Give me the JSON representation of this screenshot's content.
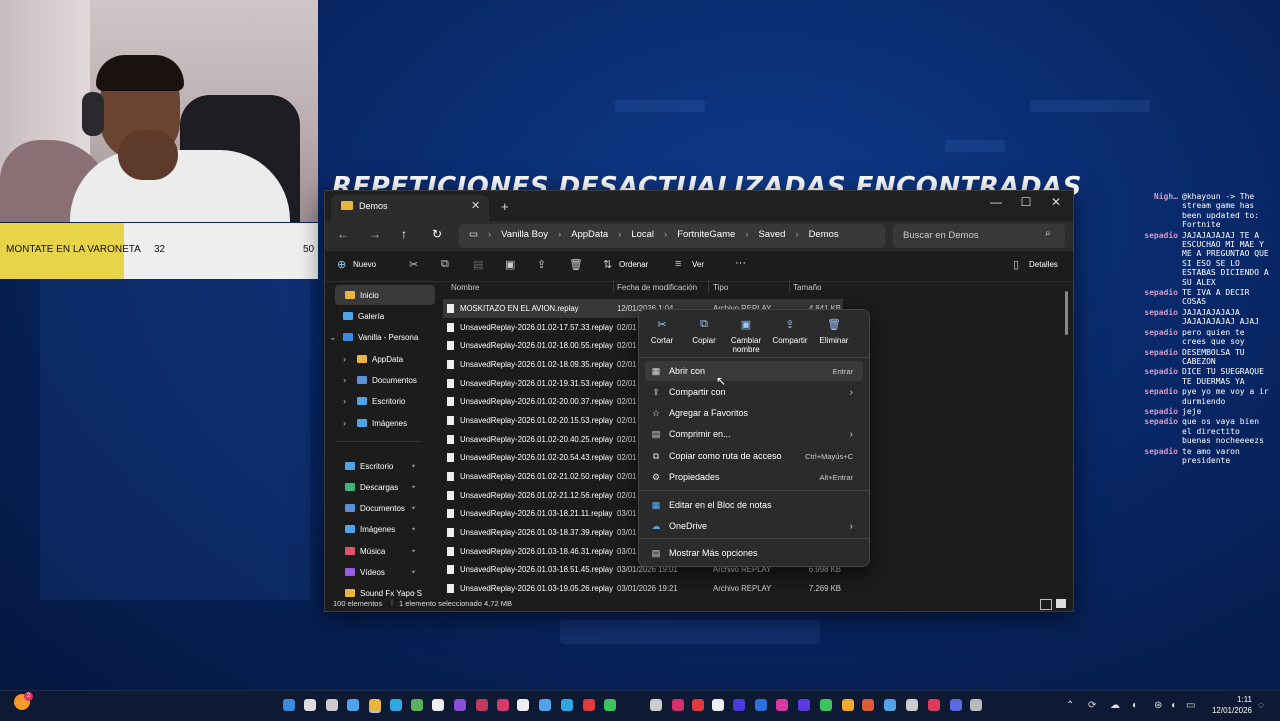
{
  "background": {
    "game_title": "REPETICIONES DESACTUALIZADAS ENCONTRADAS"
  },
  "poll": {
    "label": "MONTATE EN LA VARONETA",
    "left_value": "32",
    "right_value": "50",
    "left_fraction": 0.39,
    "accent_color": "#e8d448"
  },
  "chat": {
    "messages": [
      {
        "user": "Nigh…",
        "text": "@khayoun -> The stream game has been updated to: Fortnite"
      },
      {
        "user": "sepadio",
        "text": "JAJAJAJAJAJ TE A ESCUCHAO MI MAE Y ME A PREGUNTAO QUE SI ESO SE LO ESTABAS DICIENDO A SU ALEX"
      },
      {
        "user": "sepadio",
        "text": "TE IVA A DECIR COSAS"
      },
      {
        "user": "sepadio",
        "text": "JAJAJAJAJAJA JAJAJAJAJAJ AJAJ"
      },
      {
        "user": "sepadio",
        "text": "pero quien te crees que soy"
      },
      {
        "user": "sepadio",
        "text": "DESEMBOLSA TU CABEZON"
      },
      {
        "user": "sepadio",
        "text": "DICE TU SUEGRAQUE TE DUERMAS YA"
      },
      {
        "user": "sepadio",
        "text": "pye yo me voy a ir durmiendo"
      },
      {
        "user": "sepadio",
        "text": "jeje"
      },
      {
        "user": "sepadio",
        "text": "que os vaya bien el directito buenas nocheeeezs"
      },
      {
        "user": "sepadio",
        "text": "te amo varon presidente"
      }
    ]
  },
  "explorer": {
    "tab_title": "Demos",
    "breadcrumbs": [
      "Vanilla Boy",
      "AppData",
      "Local",
      "FortniteGame",
      "Saved",
      "Demos"
    ],
    "search_placeholder": "Buscar en Demos",
    "toolbar": {
      "new_label": "Nuevo",
      "sort_label": "Ordenar",
      "view_label": "Ver",
      "more_label": "···",
      "details_label": "Detalles"
    },
    "columns": {
      "name": "Nombre",
      "date": "Fecha de modificación",
      "type": "Tipo",
      "size": "Tamaño"
    },
    "sidebar": [
      {
        "label": "Inicio",
        "selected": true,
        "color": "#e9b53f"
      },
      {
        "label": "Galería",
        "color": "#4fa3e8"
      },
      {
        "label": "Vanilla - Persona",
        "color": "#3b8be0"
      },
      {
        "label": "AppData",
        "color": "#e9b53f"
      },
      {
        "label": "Documentos",
        "color": "#5b8fd6"
      },
      {
        "label": "Escritorio",
        "color": "#4fa3e8"
      },
      {
        "label": "Imágenes",
        "color": "#4fa3e8"
      },
      {
        "label": "Escritorio",
        "color": "#4fa3e8"
      },
      {
        "label": "Descargas",
        "color": "#3fb47a"
      },
      {
        "label": "Documentos",
        "color": "#5b8fd6"
      },
      {
        "label": "Imágenes",
        "color": "#4fa3e8"
      },
      {
        "label": "Música",
        "color": "#e0526d"
      },
      {
        "label": "Vídeos",
        "color": "#9a5ce0"
      },
      {
        "label": "Sound Fx Yapo S",
        "color": "#e9b53f"
      }
    ],
    "files": [
      {
        "name": "MOSKITAZO EN EL AVION.replay",
        "date": "12/01/2026 1:04",
        "type": "Archivo REPLAY",
        "size": "4.841 KB",
        "selected": true
      },
      {
        "name": "UnsavedReplay-2026.01.02-17.57.33.replay",
        "date": "02/01",
        "type": "",
        "size": ""
      },
      {
        "name": "UnsavedReplay-2026.01.02-18.00.55.replay",
        "date": "02/01",
        "type": "",
        "size": ""
      },
      {
        "name": "UnsavedReplay-2026.01.02-18.09.35.replay",
        "date": "02/01",
        "type": "",
        "size": ""
      },
      {
        "name": "UnsavedReplay-2026.01.02-19.31.53.replay",
        "date": "02/01",
        "type": "",
        "size": ""
      },
      {
        "name": "UnsavedReplay-2026.01.02-20.00.37.replay",
        "date": "02/01",
        "type": "",
        "size": ""
      },
      {
        "name": "UnsavedReplay-2026.01.02-20.15.53.replay",
        "date": "02/01",
        "type": "",
        "size": ""
      },
      {
        "name": "UnsavedReplay-2026.01.02-20.40.25.replay",
        "date": "02/01",
        "type": "",
        "size": ""
      },
      {
        "name": "UnsavedReplay-2026.01.02-20.54.43.replay",
        "date": "02/01",
        "type": "",
        "size": ""
      },
      {
        "name": "UnsavedReplay-2026.01.02-21.02.50.replay",
        "date": "02/01",
        "type": "",
        "size": ""
      },
      {
        "name": "UnsavedReplay-2026.01.02-21.12.56.replay",
        "date": "02/01",
        "type": "",
        "size": ""
      },
      {
        "name": "UnsavedReplay-2026.01.03-18.21.11.replay",
        "date": "03/01",
        "type": "",
        "size": ""
      },
      {
        "name": "UnsavedReplay-2026.01.03-18.37.39.replay",
        "date": "03/01",
        "type": "",
        "size": ""
      },
      {
        "name": "UnsavedReplay-2026.01.03-18.46.31.replay",
        "date": "03/01",
        "type": "",
        "size": ""
      },
      {
        "name": "UnsavedReplay-2026.01.03-18.51.45.replay",
        "date": "03/01/2026 19:01",
        "type": "Archivo REPLAY",
        "size": "6.998 KB"
      },
      {
        "name": "UnsavedReplay-2026.01.03-19.05.26.replay",
        "date": "03/01/2026 19:21",
        "type": "Archivo REPLAY",
        "size": "7.269 KB"
      }
    ],
    "status": {
      "count": "100 elementos",
      "selection": "1 elemento seleccionado 4,72 MB"
    }
  },
  "context_menu": {
    "quick_actions": [
      {
        "label": "Cortar",
        "icon": "scissors-icon"
      },
      {
        "label": "Copiar",
        "icon": "copy-icon"
      },
      {
        "label": "Cambiar nombre",
        "icon": "rename-icon"
      },
      {
        "label": "Compartir",
        "icon": "share-icon"
      },
      {
        "label": "Eliminar",
        "icon": "trash-icon"
      }
    ],
    "items": [
      {
        "label": "Abrir con",
        "shortcut": "Entrar",
        "submenu": false
      },
      {
        "label": "Compartir con",
        "shortcut": "",
        "submenu": true
      },
      {
        "label": "Agregar a Favoritos",
        "shortcut": "",
        "submenu": false
      },
      {
        "label": "Comprimir en...",
        "shortcut": "",
        "submenu": true
      },
      {
        "label": "Copiar como ruta de acceso",
        "shortcut": "Ctrl+Mayús+C",
        "submenu": false
      },
      {
        "label": "Propiedades",
        "shortcut": "Alt+Entrar",
        "submenu": false
      },
      {
        "label": "Editar en el Bloc de notas",
        "shortcut": "",
        "submenu": false
      },
      {
        "label": "OneDrive",
        "shortcut": "",
        "submenu": true
      },
      {
        "label": "Mostrar Más opciones",
        "shortcut": "",
        "submenu": false
      }
    ]
  },
  "taskbar": {
    "time": "1:11",
    "date": "12/01/2026",
    "notification_count": "2"
  }
}
